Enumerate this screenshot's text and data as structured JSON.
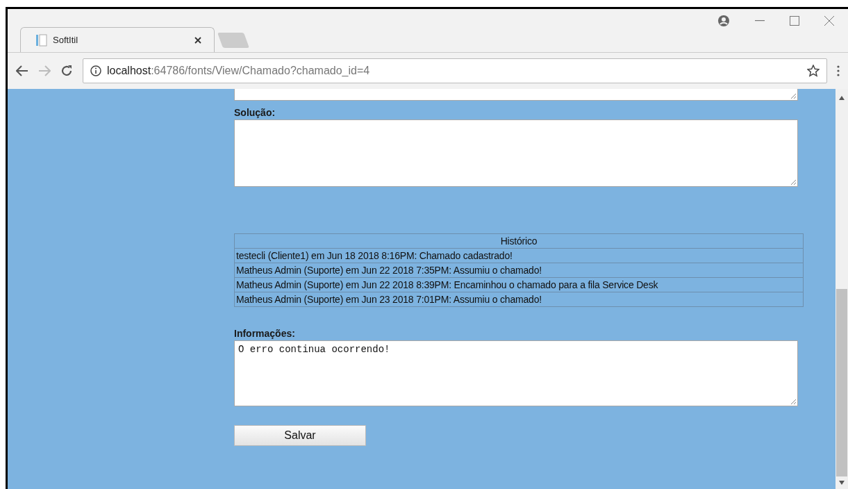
{
  "browser": {
    "tabs": [
      {
        "title": "SoftItil",
        "selected": true
      }
    ],
    "address": {
      "host": "localhost",
      "rest": ":64786/fonts/View/Chamado?chamado_id=4"
    }
  },
  "form": {
    "solution": {
      "label": "Solução:"
    },
    "history": {
      "title": "Histórico",
      "rows": [
        "testecli (Cliente1) em Jun 18 2018 8:16PM: Chamado cadastrado!",
        "Matheus Admin (Suporte) em Jun 22 2018 7:35PM: Assumiu o chamado!",
        "Matheus Admin (Suporte) em Jun 22 2018 8:39PM: Encaminhou o chamado para a fila Service Desk",
        "Matheus Admin (Suporte) em Jun 23 2018 7:01PM: Assumiu o chamado!"
      ]
    },
    "info": {
      "label": "Informações:",
      "value": "O erro continua ocorrendo!"
    },
    "save_button": "Salvar"
  }
}
